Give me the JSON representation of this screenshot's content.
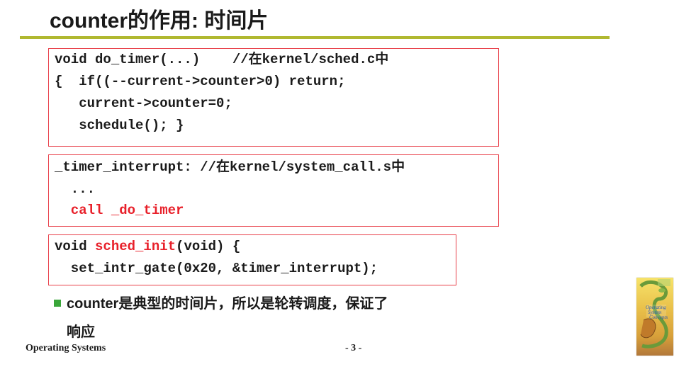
{
  "slide": {
    "title": "counter的作用: 时间片",
    "box1": {
      "line1": "void do_timer(...)    //在kernel/sched.c中",
      "line2": "{  if((--current->counter>0) return;",
      "line3": "   current->counter=0;",
      "line4": "   schedule(); }"
    },
    "box2": {
      "line1": "_timer_interrupt: //在kernel/system_call.s中",
      "line2": "  ...",
      "line3": "  call _do_timer"
    },
    "box3": {
      "line1_a": "void ",
      "line1_b": "sched_init",
      "line1_c": "(void) {",
      "line2": "  set_intr_gate(0x20, &timer_interrupt);"
    },
    "bullet": {
      "text_line1": "counter是典型的时间片，所以是轮转调度，保证了",
      "text_line2": "响应"
    },
    "footer": {
      "left": "Operating Systems",
      "page": "- 3 -"
    },
    "colors": {
      "accent_rule": "#b0b830",
      "box_border": "#e8404a",
      "highlight": "#e8202a",
      "bullet": "#3aa63a"
    }
  }
}
